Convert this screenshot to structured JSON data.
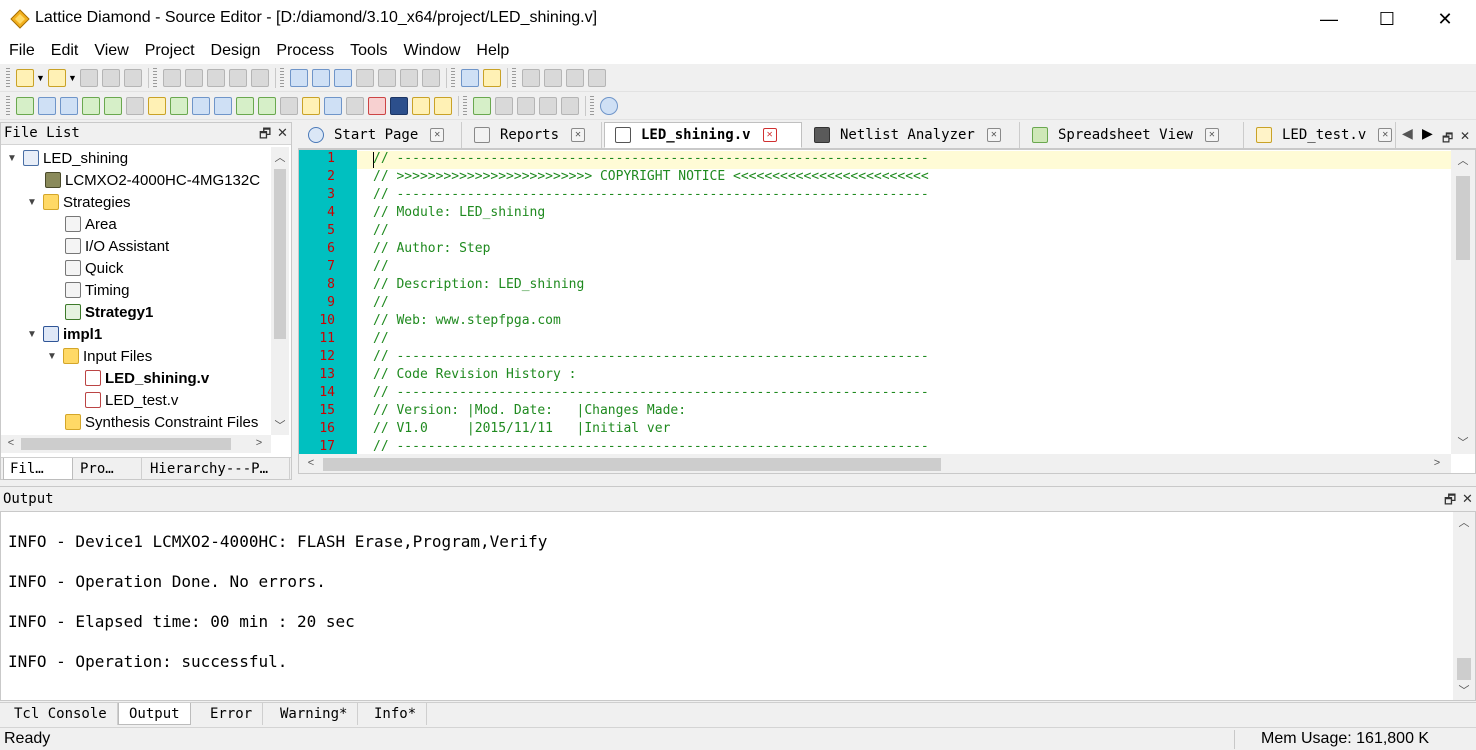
{
  "window": {
    "title": "Lattice Diamond - Source Editor - [D:/diamond/3.10_x64/project/LED_shining.v]",
    "minimize": "—",
    "maximize": "☐",
    "close": "✕"
  },
  "menu": [
    "File",
    "Edit",
    "View",
    "Project",
    "Design",
    "Process",
    "Tools",
    "Window",
    "Help"
  ],
  "file_list": {
    "title": "File List",
    "tree": [
      {
        "label": "LED_shining",
        "expanded": true
      },
      {
        "label": "LCMXO2-4000HC-4MG132C"
      },
      {
        "label": "Strategies",
        "expanded": true
      },
      {
        "label": "Area"
      },
      {
        "label": "I/O Assistant"
      },
      {
        "label": "Quick"
      },
      {
        "label": "Timing"
      },
      {
        "label": "Strategy1"
      },
      {
        "label": "impl1",
        "expanded": true
      },
      {
        "label": "Input Files",
        "expanded": true
      },
      {
        "label": "LED_shining.v"
      },
      {
        "label": "LED_test.v"
      },
      {
        "label": "Synthesis Constraint Files"
      }
    ],
    "tabs": [
      "Fil…",
      "Pro…",
      "Hierarchy---P…"
    ]
  },
  "editor_tabs": [
    {
      "label": "Start Page"
    },
    {
      "label": "Reports"
    },
    {
      "label": "LED_shining.v",
      "active": true
    },
    {
      "label": "Netlist Analyzer"
    },
    {
      "label": "Spreadsheet View"
    },
    {
      "label": "LED_test.v"
    }
  ],
  "code": {
    "line_numbers": [
      "1",
      "2",
      "3",
      "4",
      "5",
      "6",
      "7",
      "8",
      "9",
      "10",
      "11",
      "12",
      "13",
      "14",
      "15",
      "16",
      "17"
    ],
    "lines": [
      "// --------------------------------------------------------------------",
      "// >>>>>>>>>>>>>>>>>>>>>>>>> COPYRIGHT NOTICE <<<<<<<<<<<<<<<<<<<<<<<<<",
      "// --------------------------------------------------------------------",
      "// Module: LED_shining",
      "//",
      "// Author: Step",
      "//",
      "// Description: LED_shining",
      "//",
      "// Web: www.stepfpga.com",
      "//",
      "// --------------------------------------------------------------------",
      "// Code Revision History :",
      "// --------------------------------------------------------------------",
      "// Version: |Mod. Date:   |Changes Made:",
      "// V1.0     |2015/11/11   |Initial ver",
      "// --------------------------------------------------------------------"
    ]
  },
  "output": {
    "title": "Output",
    "lines": [
      "INFO - Device1 LCMXO2-4000HC: FLASH Erase,Program,Verify",
      "INFO - Operation Done. No errors.",
      "INFO - Elapsed time: 00 min : 20 sec",
      "INFO - Operation: successful."
    ],
    "tabs": [
      "Tcl Console",
      "Output",
      "Error",
      "Warning*",
      "Info*"
    ]
  },
  "status": {
    "text": "Ready",
    "mem_usage": "Mem Usage: 161,800 K"
  },
  "colors": {
    "gutter": "#00c0c0",
    "line_numbers": "#cc0000",
    "comment": "#1f8a1f"
  }
}
